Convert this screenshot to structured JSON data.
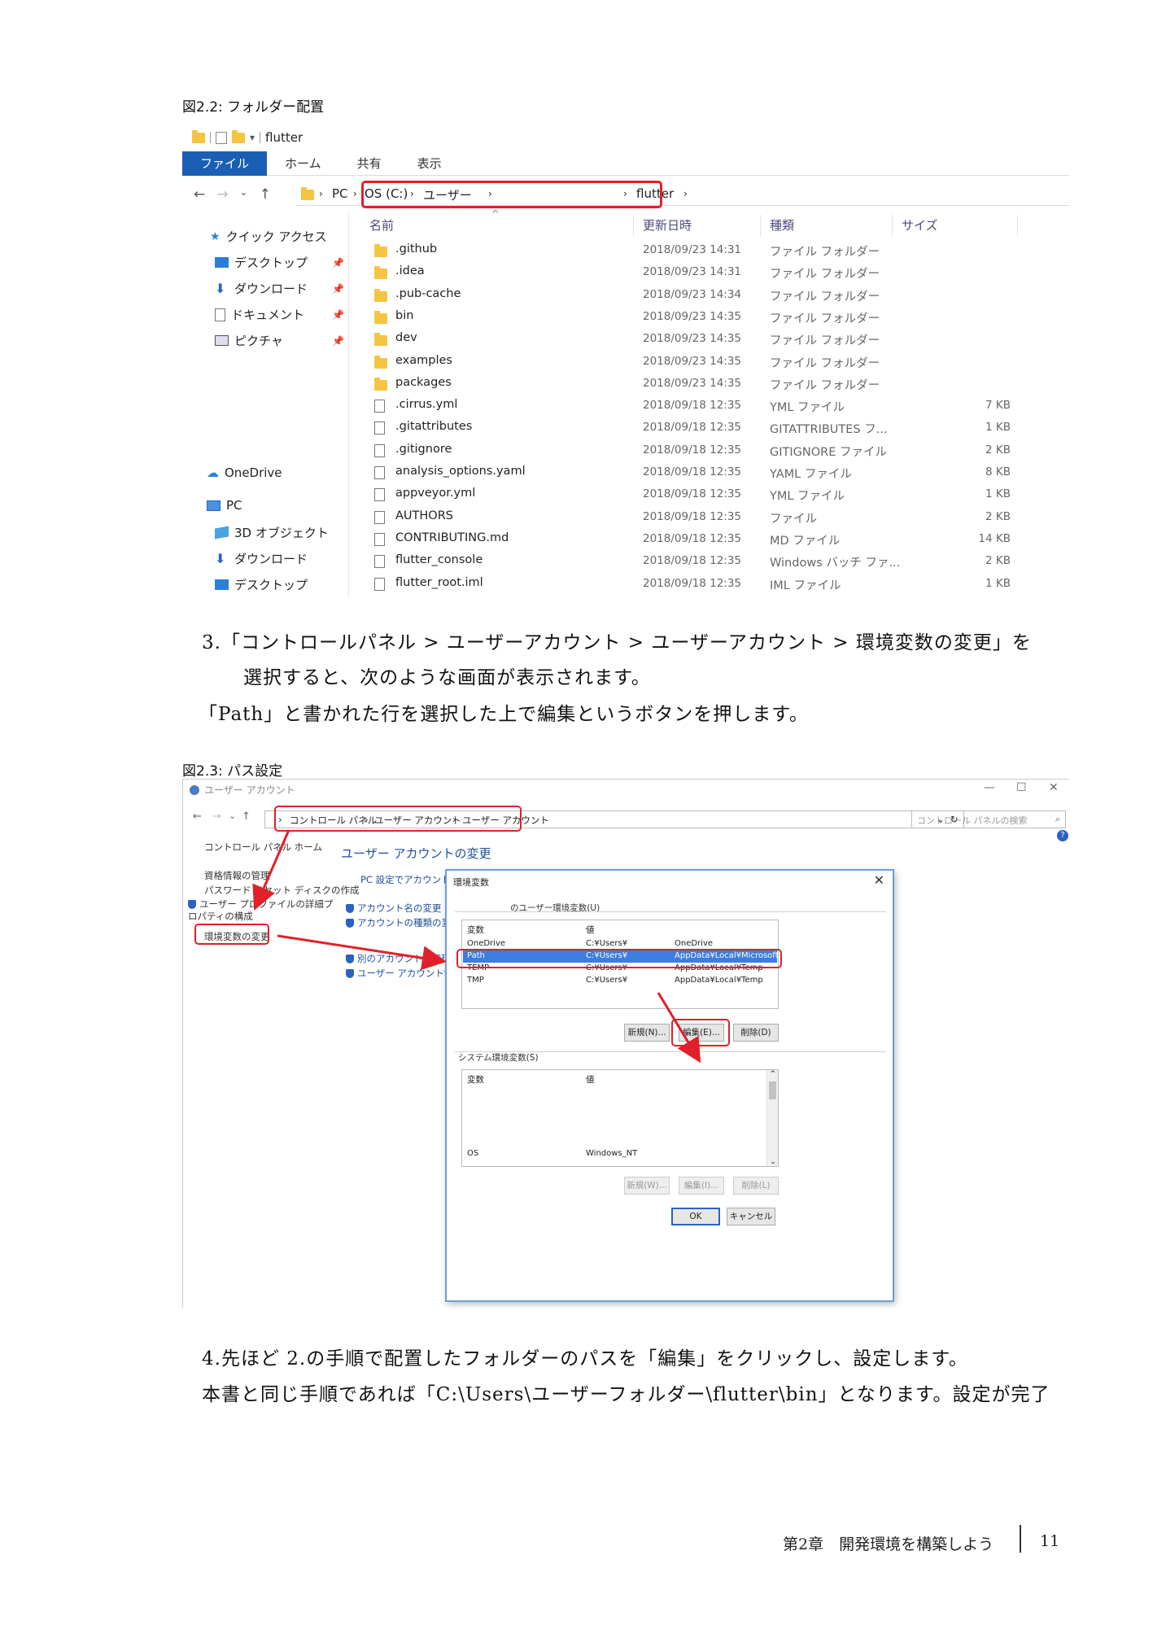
{
  "fig1": {
    "caption": "図2.2: フォルダー配置",
    "window_title": "flutter",
    "ribbon_tabs": [
      "ファイル",
      "ホーム",
      "共有",
      "表示"
    ],
    "breadcrumb": [
      "PC",
      "OS (C:)",
      "ユーザー",
      "flutter"
    ],
    "columns": [
      "名前",
      "更新日時",
      "種類",
      "サイズ"
    ],
    "nav": {
      "quick_access": "クイック アクセス",
      "qa_items": [
        "デスクトップ",
        "ダウンロード",
        "ドキュメント",
        "ピクチャ"
      ],
      "onedrive": "OneDrive",
      "pc": "PC",
      "pc_items": [
        "3D オブジェクト",
        "ダウンロード",
        "デスクトップ"
      ]
    },
    "files": [
      {
        "name": ".github",
        "date": "2018/09/23 14:31",
        "type": "ファイル フォルダー",
        "size": "",
        "kind": "folder"
      },
      {
        "name": ".idea",
        "date": "2018/09/23 14:31",
        "type": "ファイル フォルダー",
        "size": "",
        "kind": "folder"
      },
      {
        "name": ".pub-cache",
        "date": "2018/09/23 14:34",
        "type": "ファイル フォルダー",
        "size": "",
        "kind": "folder"
      },
      {
        "name": "bin",
        "date": "2018/09/23 14:35",
        "type": "ファイル フォルダー",
        "size": "",
        "kind": "folder"
      },
      {
        "name": "dev",
        "date": "2018/09/23 14:35",
        "type": "ファイル フォルダー",
        "size": "",
        "kind": "folder"
      },
      {
        "name": "examples",
        "date": "2018/09/23 14:35",
        "type": "ファイル フォルダー",
        "size": "",
        "kind": "folder"
      },
      {
        "name": "packages",
        "date": "2018/09/23 14:35",
        "type": "ファイル フォルダー",
        "size": "",
        "kind": "folder"
      },
      {
        "name": ".cirrus.yml",
        "date": "2018/09/18 12:35",
        "type": "YML ファイル",
        "size": "7 KB",
        "kind": "file"
      },
      {
        "name": ".gitattributes",
        "date": "2018/09/18 12:35",
        "type": "GITATTRIBUTES フ...",
        "size": "1 KB",
        "kind": "file"
      },
      {
        "name": ".gitignore",
        "date": "2018/09/18 12:35",
        "type": "GITIGNORE ファイル",
        "size": "2 KB",
        "kind": "file"
      },
      {
        "name": "analysis_options.yaml",
        "date": "2018/09/18 12:35",
        "type": "YAML ファイル",
        "size": "8 KB",
        "kind": "file"
      },
      {
        "name": "appveyor.yml",
        "date": "2018/09/18 12:35",
        "type": "YML ファイル",
        "size": "1 KB",
        "kind": "file"
      },
      {
        "name": "AUTHORS",
        "date": "2018/09/18 12:35",
        "type": "ファイル",
        "size": "2 KB",
        "kind": "file"
      },
      {
        "name": "CONTRIBUTING.md",
        "date": "2018/09/18 12:35",
        "type": "MD ファイル",
        "size": "14 KB",
        "kind": "file"
      },
      {
        "name": "flutter_console",
        "date": "2018/09/18 12:35",
        "type": "Windows バッチ ファ...",
        "size": "2 KB",
        "kind": "file"
      },
      {
        "name": "flutter_root.iml",
        "date": "2018/09/18 12:35",
        "type": "IML ファイル",
        "size": "1 KB",
        "kind": "file"
      }
    ]
  },
  "text": {
    "step3_line1": "3.「コントロールパネル > ユーザーアカウント > ユーザーアカウント > 環境変数の変更」を",
    "step3_line2": "選択すると、次のような画面が表示されます。",
    "step3_line3": "「Path」と書かれた行を選択した上で編集というボタンを押します。",
    "step4_line1": "4.先ほど 2.の手順で配置したフォルダーのパスを「編集」をクリックし、設定します。",
    "step4_line2": "本書と同じ手順であれば「C:\\Users\\ユーザーフォルダー\\flutter\\bin」となります。設定が完了"
  },
  "fig2": {
    "caption": "図2.3: パス設定",
    "window_title": "ユーザー アカウント",
    "breadcrumb": [
      "コントロール パネル",
      "ユーザー アカウント",
      "ユーザー アカウント"
    ],
    "search_placeholder": "コントロール パネルの検索",
    "left_links": [
      "コントロール パネル ホーム",
      "資格情報の管理",
      "パスワード リセット ディスクの作成",
      "ユーザー プロファイルの詳細プロパティの構成",
      "環境変数の変更"
    ],
    "main_title": "ユーザー アカウントの変更",
    "main_links": [
      "PC 設定でアカウントを変更",
      "アカウント名の変更",
      "アカウントの種類の変更",
      "別のアカウントの管理",
      "ユーザー アカウント制御設定の変更"
    ],
    "dialog": {
      "title": "環境変数",
      "user_group": "のユーザー環境変数(U)",
      "col_var": "変数",
      "col_val": "値",
      "user_rows": [
        {
          "var": "OneDrive",
          "val1": "C:¥Users¥",
          "val2": "OneDrive"
        },
        {
          "var": "Path",
          "val1": "C:¥Users¥",
          "val2": "AppData¥Local¥Microsoft¥WindowsApps;C:¥Us..."
        },
        {
          "var": "TEMP",
          "val1": "C:¥Users¥",
          "val2": "AppData¥Local¥Temp"
        },
        {
          "var": "TMP",
          "val1": "C:¥Users¥",
          "val2": "AppData¥Local¥Temp"
        }
      ],
      "user_buttons": [
        "新規(N)...",
        "編集(E)...",
        "削除(D)"
      ],
      "system_group": "システム環境変数(S)",
      "system_rows": [
        {
          "var": "OS",
          "val": "Windows_NT"
        }
      ],
      "system_buttons": [
        "新規(W)...",
        "編集(I)...",
        "削除(L)"
      ],
      "ok": "OK",
      "cancel": "キャンセル"
    }
  },
  "footer": {
    "chapter": "第2章　開発環境を構築しよう",
    "page": "11"
  }
}
